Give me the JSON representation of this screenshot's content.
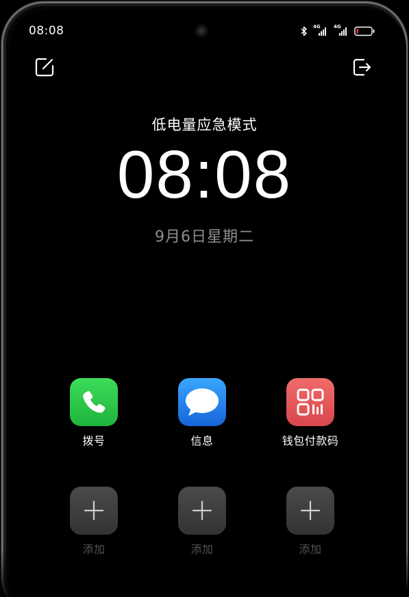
{
  "status_bar": {
    "time": "08:08",
    "network_1": "4G",
    "network_2": "4G"
  },
  "top_actions": {
    "left_icon": "edit-icon",
    "right_icon": "exit-icon"
  },
  "main": {
    "mode_title": "低电量应急模式",
    "clock": "08:08",
    "date": "9月6日星期二"
  },
  "apps": [
    {
      "label": "拨号",
      "icon": "phone-icon",
      "color": "#2ecc4a"
    },
    {
      "label": "信息",
      "icon": "message-icon",
      "color": "#1e88f0"
    },
    {
      "label": "钱包付款码",
      "icon": "qr-code-icon",
      "color": "#e8575a"
    }
  ],
  "add_slots": [
    {
      "label": "添加",
      "icon": "plus-icon"
    },
    {
      "label": "添加",
      "icon": "plus-icon"
    },
    {
      "label": "添加",
      "icon": "plus-icon"
    }
  ],
  "colors": {
    "background": "#000000",
    "date_text": "#8e8e8e",
    "add_label": "#555555"
  }
}
